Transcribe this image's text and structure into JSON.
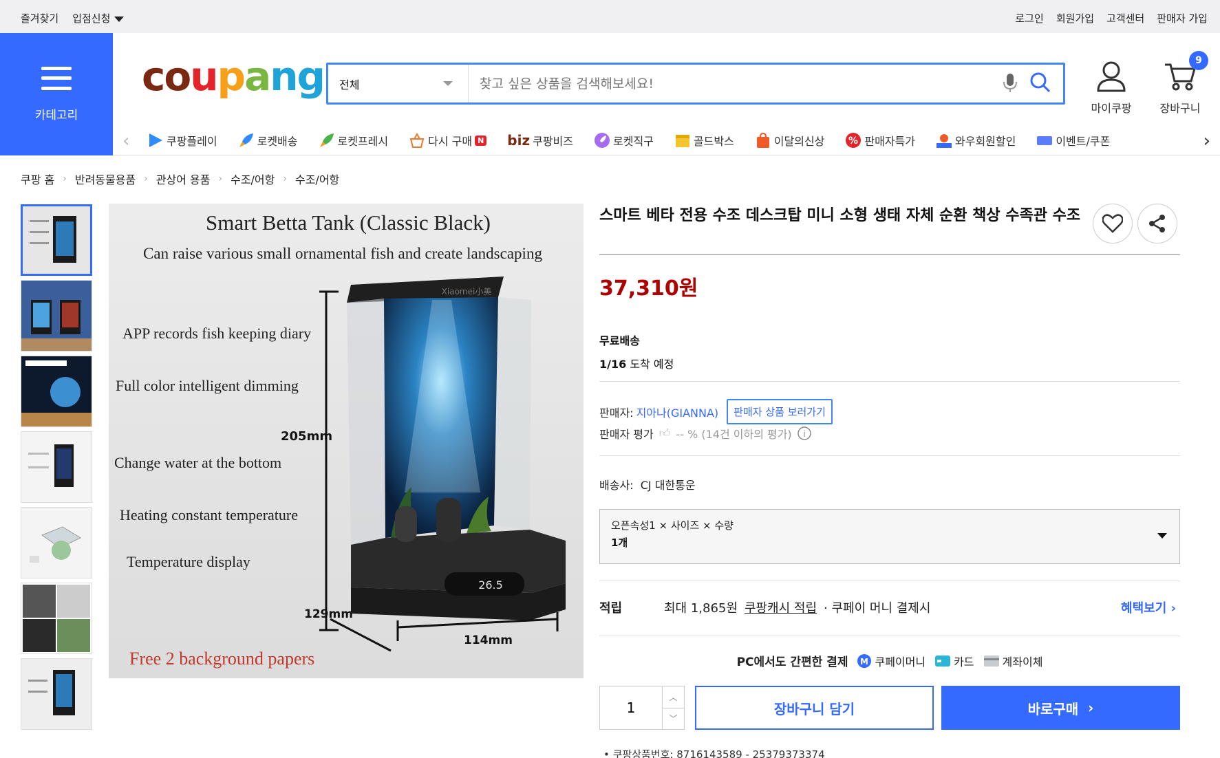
{
  "topbar": {
    "favorites": "즐겨찾기",
    "partner_apply": "입점신청",
    "login": "로그인",
    "signup": "회원가입",
    "customer_center": "고객센터",
    "seller_signup": "판매자 가입"
  },
  "category": {
    "label": "카테고리"
  },
  "logo": {
    "text": "coupang"
  },
  "search": {
    "scope": "전체",
    "placeholder": "찾고 싶은 상품을 검색해보세요!"
  },
  "account": {
    "my_coupang": "마이쿠팡",
    "cart": "장바구니",
    "cart_count": "9"
  },
  "nav": {
    "items": [
      {
        "label": "쿠팡플레이",
        "icon": "play-icon"
      },
      {
        "label": "로켓배송",
        "icon": "rocket-icon"
      },
      {
        "label": "로켓프레시",
        "icon": "rocket-fresh-icon"
      },
      {
        "label": "다시 구매",
        "icon": "rebuy-basket-icon",
        "badge": "N"
      },
      {
        "label": "쿠팡비즈",
        "prefix": "biz"
      },
      {
        "label": "로켓직구",
        "icon": "global-rocket-icon"
      },
      {
        "label": "골드박스",
        "icon": "goldbox-icon"
      },
      {
        "label": "이달의신상",
        "icon": "new-bag-icon"
      },
      {
        "label": "판매자특가",
        "icon": "percent-icon"
      },
      {
        "label": "와우회원할인",
        "icon": "wow-icon"
      },
      {
        "label": "이벤트/쿠폰",
        "icon": "coupon-icon"
      }
    ]
  },
  "breadcrumb": [
    "쿠팡 홈",
    "반려동물용품",
    "관상어 용품",
    "수조/어항",
    "수조/어항"
  ],
  "gallery": {
    "thumbnail_count": 7,
    "active_index": 0,
    "main_image": {
      "heading": "Smart Betta Tank (Classic Black)",
      "subheading": "Can raise various small ornamental fish and create landscaping",
      "features": [
        "APP records fish keeping diary",
        "Full color intelligent dimming",
        "Change water at the bottom",
        "Heating constant temperature",
        "Temperature display"
      ],
      "height_dim": "205mm",
      "depth_dim": "129mm",
      "width_dim": "114mm",
      "display_temp": "26.5",
      "footer": "Free 2 background papers",
      "brand": "Xiaomei小美"
    }
  },
  "product": {
    "title": "스마트 베타 전용 수조 데스크탑 미니 소형 생태 자체 순환 책상 수족관 수조",
    "price": "37,310원",
    "shipping_label": "무료배송",
    "arrival_date": "1/16",
    "arrival_text": " 도착 예정",
    "seller_label": "판매자: ",
    "seller_name": "지아나(GIANNA)",
    "seller_products_link": "판매자 상품 보러가기",
    "seller_rating_label": "판매자 평가",
    "seller_rating_value": "-- % (14건 이하의 평가)",
    "carrier_label": "배송사:",
    "carrier_name": "CJ 대한통운",
    "option_line1": "오픈속성1 × 사이즈 × 수량",
    "option_line2": "1개",
    "reward_label": "적립",
    "reward_amount": "최대 1,865원",
    "reward_link": "쿠팡캐시 적립",
    "reward_condition": "· 쿠페이 머니 결제시",
    "reward_more": "혜택보기",
    "pay_heading": "PC에서도 간편한 결제",
    "pay_methods": [
      "쿠페이머니",
      "카드",
      "계좌이체"
    ],
    "quantity": "1",
    "add_to_cart": "장바구니 담기",
    "buy_now": "바로구매",
    "product_number": "쿠팡상품번호: 8716143589 - 25379373374"
  },
  "colors": {
    "accent": "#346aff",
    "price": "#ae0000",
    "topbar_bg": "#f0f0f2"
  }
}
